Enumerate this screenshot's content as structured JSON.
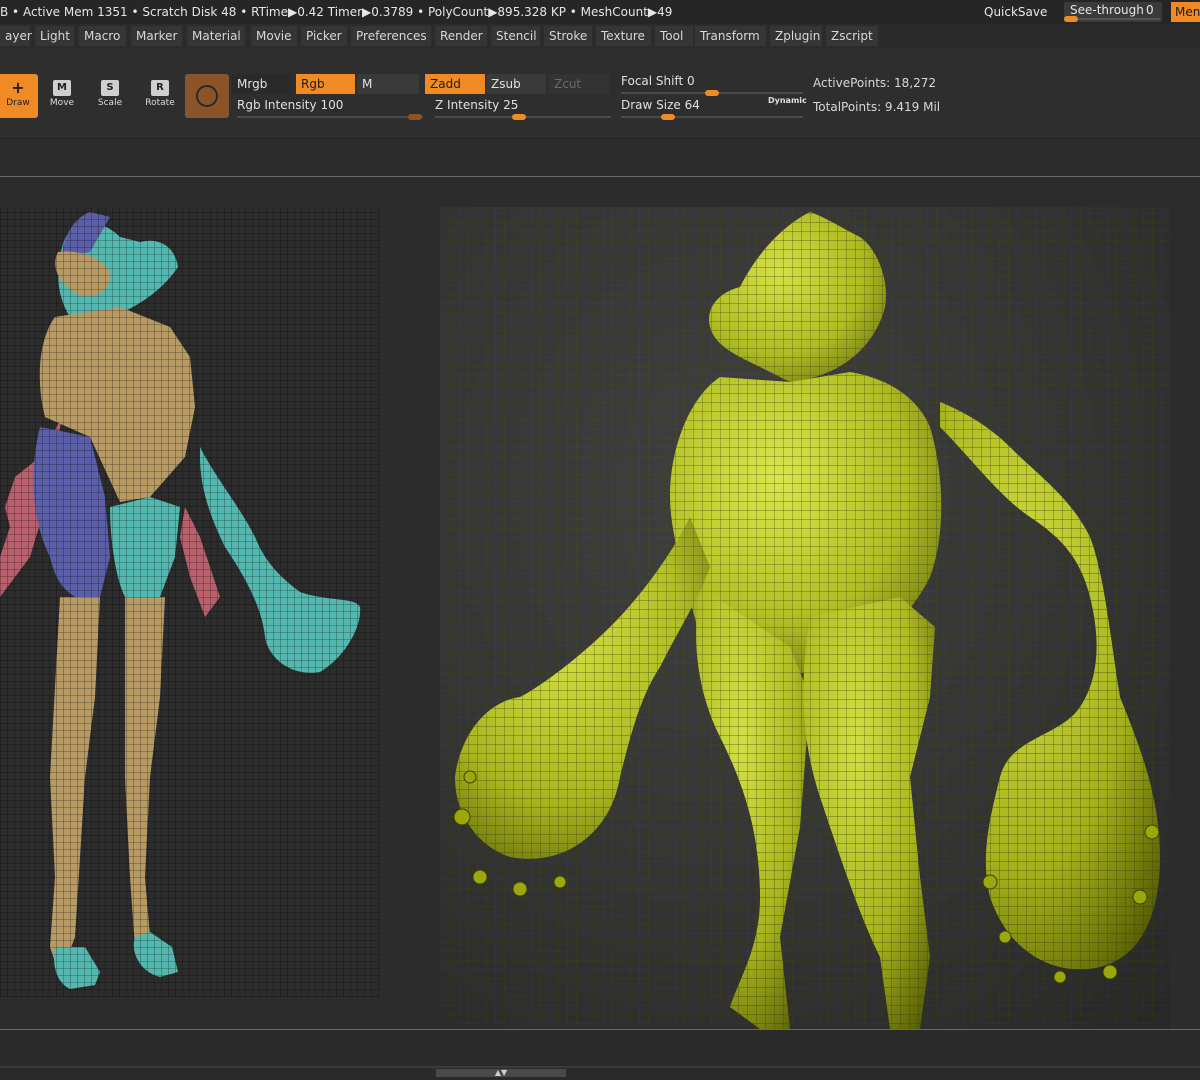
{
  "status": {
    "text": "B • Active Mem 1351 • Scratch Disk 48 • RTime▶0.42 Timer▶0.3789 • PolyCount▶895.328 KP • MeshCount▶49",
    "quicksave": "QuickSave",
    "see_through_label": "See-through",
    "see_through_value": "0",
    "menus_label": "Menus"
  },
  "menus": [
    "ayer",
    "Light",
    "Macro",
    "Marker",
    "Material",
    "Movie",
    "Picker",
    "Preferences",
    "Render",
    "Stencil",
    "Stroke",
    "Texture",
    "Tool",
    "Transform",
    "Zplugin",
    "Zscript"
  ],
  "tools": {
    "draw": {
      "label": "Draw",
      "key": "+"
    },
    "move": {
      "label": "Move",
      "key": "M"
    },
    "scale": {
      "label": "Scale",
      "key": "S"
    },
    "rotate": {
      "label": "Rotate",
      "key": "R"
    }
  },
  "toggles": {
    "mrgb": "Mrgb",
    "rgb": "Rgb",
    "m": "M",
    "zadd": "Zadd",
    "zsub": "Zsub",
    "zcut": "Zcut"
  },
  "sliders": {
    "rgb_intensity": {
      "label": "Rgb Intensity",
      "value": "100"
    },
    "z_intensity": {
      "label": "Z Intensity",
      "value": "25"
    },
    "focal_shift": {
      "label": "Focal Shift",
      "value": "0"
    },
    "draw_size": {
      "label": "Draw Size",
      "value": "64"
    },
    "dynamic_label": "Dynamic"
  },
  "info": {
    "active_points": "ActivePoints: 18,272",
    "total_points": "TotalPoints: 9.419 Mil"
  },
  "colors": {
    "accent": "#f08a24",
    "creature_lime": "#b5c414",
    "polygroup_blue": "#5b5fa8",
    "polygroup_cyan": "#55b8b0",
    "polygroup_tan": "#b89a64",
    "polygroup_pink": "#b8606c"
  }
}
